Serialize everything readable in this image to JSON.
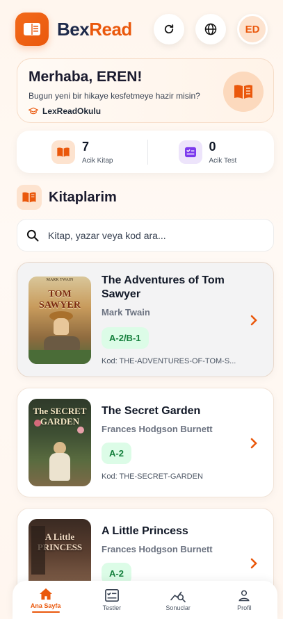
{
  "header": {
    "brand_part1": "Bex",
    "brand_part2": "Read",
    "avatar_initials": "ED",
    "icons": [
      "book-icon",
      "refresh-icon",
      "globe-icon"
    ]
  },
  "welcome": {
    "greeting": "Merhaba, EREN!",
    "subtitle": "Bugun yeni bir hikaye kesfetmeye hazir misin?",
    "school": "LexReadOkulu"
  },
  "stats": [
    {
      "value": "7",
      "label": "Acik Kitap",
      "icon": "book-open-icon"
    },
    {
      "value": "0",
      "label": "Acik Test",
      "icon": "checklist-icon"
    }
  ],
  "library": {
    "title": "Kitaplarim",
    "search_placeholder": "Kitap, yazar veya kod ara..."
  },
  "books": [
    {
      "title": "The Adventures of Tom Sawyer",
      "author": "Mark Twain",
      "level": "A-2/B-1",
      "code": "Kod: THE-ADVENTURES-OF-TOM-S...",
      "cover_top": "MARK TWAIN",
      "cover_title": "TOM SAWYER"
    },
    {
      "title": "The Secret Garden",
      "author": "Frances Hodgson Burnett",
      "level": "A-2",
      "code": "Kod: THE-SECRET-GARDEN",
      "cover_title": "The SECRET GARDEN"
    },
    {
      "title": "A Little Princess",
      "author": "Frances Hodgson Burnett",
      "level": "A-2",
      "cover_title": "A Little PRINCESS"
    }
  ],
  "tabs": [
    {
      "label": "Ana Sayfa",
      "icon": "home-icon",
      "active": true
    },
    {
      "label": "Testler",
      "icon": "test-icon",
      "active": false
    },
    {
      "label": "Sonuclar",
      "icon": "results-icon",
      "active": false
    },
    {
      "label": "Profil",
      "icon": "user-icon",
      "active": false
    }
  ],
  "colors": {
    "accent": "#ea580c",
    "level_bg": "#dcfce7",
    "level_text": "#15803d"
  }
}
